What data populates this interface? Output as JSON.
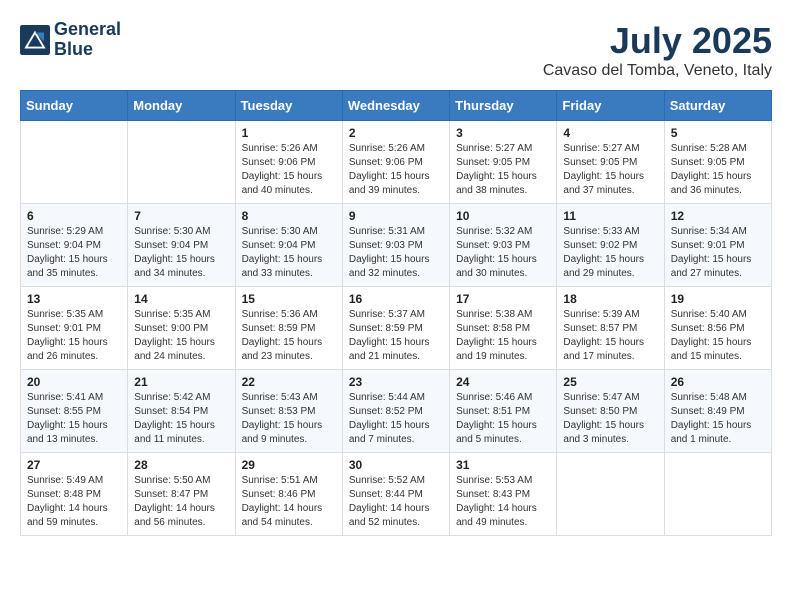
{
  "header": {
    "logo_line1": "General",
    "logo_line2": "Blue",
    "month_title": "July 2025",
    "location": "Cavaso del Tomba, Veneto, Italy"
  },
  "days_of_week": [
    "Sunday",
    "Monday",
    "Tuesday",
    "Wednesday",
    "Thursday",
    "Friday",
    "Saturday"
  ],
  "weeks": [
    [
      {
        "day": "",
        "content": ""
      },
      {
        "day": "",
        "content": ""
      },
      {
        "day": "1",
        "content": "Sunrise: 5:26 AM\nSunset: 9:06 PM\nDaylight: 15 hours and 40 minutes."
      },
      {
        "day": "2",
        "content": "Sunrise: 5:26 AM\nSunset: 9:06 PM\nDaylight: 15 hours and 39 minutes."
      },
      {
        "day": "3",
        "content": "Sunrise: 5:27 AM\nSunset: 9:05 PM\nDaylight: 15 hours and 38 minutes."
      },
      {
        "day": "4",
        "content": "Sunrise: 5:27 AM\nSunset: 9:05 PM\nDaylight: 15 hours and 37 minutes."
      },
      {
        "day": "5",
        "content": "Sunrise: 5:28 AM\nSunset: 9:05 PM\nDaylight: 15 hours and 36 minutes."
      }
    ],
    [
      {
        "day": "6",
        "content": "Sunrise: 5:29 AM\nSunset: 9:04 PM\nDaylight: 15 hours and 35 minutes."
      },
      {
        "day": "7",
        "content": "Sunrise: 5:30 AM\nSunset: 9:04 PM\nDaylight: 15 hours and 34 minutes."
      },
      {
        "day": "8",
        "content": "Sunrise: 5:30 AM\nSunset: 9:04 PM\nDaylight: 15 hours and 33 minutes."
      },
      {
        "day": "9",
        "content": "Sunrise: 5:31 AM\nSunset: 9:03 PM\nDaylight: 15 hours and 32 minutes."
      },
      {
        "day": "10",
        "content": "Sunrise: 5:32 AM\nSunset: 9:03 PM\nDaylight: 15 hours and 30 minutes."
      },
      {
        "day": "11",
        "content": "Sunrise: 5:33 AM\nSunset: 9:02 PM\nDaylight: 15 hours and 29 minutes."
      },
      {
        "day": "12",
        "content": "Sunrise: 5:34 AM\nSunset: 9:01 PM\nDaylight: 15 hours and 27 minutes."
      }
    ],
    [
      {
        "day": "13",
        "content": "Sunrise: 5:35 AM\nSunset: 9:01 PM\nDaylight: 15 hours and 26 minutes."
      },
      {
        "day": "14",
        "content": "Sunrise: 5:35 AM\nSunset: 9:00 PM\nDaylight: 15 hours and 24 minutes."
      },
      {
        "day": "15",
        "content": "Sunrise: 5:36 AM\nSunset: 8:59 PM\nDaylight: 15 hours and 23 minutes."
      },
      {
        "day": "16",
        "content": "Sunrise: 5:37 AM\nSunset: 8:59 PM\nDaylight: 15 hours and 21 minutes."
      },
      {
        "day": "17",
        "content": "Sunrise: 5:38 AM\nSunset: 8:58 PM\nDaylight: 15 hours and 19 minutes."
      },
      {
        "day": "18",
        "content": "Sunrise: 5:39 AM\nSunset: 8:57 PM\nDaylight: 15 hours and 17 minutes."
      },
      {
        "day": "19",
        "content": "Sunrise: 5:40 AM\nSunset: 8:56 PM\nDaylight: 15 hours and 15 minutes."
      }
    ],
    [
      {
        "day": "20",
        "content": "Sunrise: 5:41 AM\nSunset: 8:55 PM\nDaylight: 15 hours and 13 minutes."
      },
      {
        "day": "21",
        "content": "Sunrise: 5:42 AM\nSunset: 8:54 PM\nDaylight: 15 hours and 11 minutes."
      },
      {
        "day": "22",
        "content": "Sunrise: 5:43 AM\nSunset: 8:53 PM\nDaylight: 15 hours and 9 minutes."
      },
      {
        "day": "23",
        "content": "Sunrise: 5:44 AM\nSunset: 8:52 PM\nDaylight: 15 hours and 7 minutes."
      },
      {
        "day": "24",
        "content": "Sunrise: 5:46 AM\nSunset: 8:51 PM\nDaylight: 15 hours and 5 minutes."
      },
      {
        "day": "25",
        "content": "Sunrise: 5:47 AM\nSunset: 8:50 PM\nDaylight: 15 hours and 3 minutes."
      },
      {
        "day": "26",
        "content": "Sunrise: 5:48 AM\nSunset: 8:49 PM\nDaylight: 15 hours and 1 minute."
      }
    ],
    [
      {
        "day": "27",
        "content": "Sunrise: 5:49 AM\nSunset: 8:48 PM\nDaylight: 14 hours and 59 minutes."
      },
      {
        "day": "28",
        "content": "Sunrise: 5:50 AM\nSunset: 8:47 PM\nDaylight: 14 hours and 56 minutes."
      },
      {
        "day": "29",
        "content": "Sunrise: 5:51 AM\nSunset: 8:46 PM\nDaylight: 14 hours and 54 minutes."
      },
      {
        "day": "30",
        "content": "Sunrise: 5:52 AM\nSunset: 8:44 PM\nDaylight: 14 hours and 52 minutes."
      },
      {
        "day": "31",
        "content": "Sunrise: 5:53 AM\nSunset: 8:43 PM\nDaylight: 14 hours and 49 minutes."
      },
      {
        "day": "",
        "content": ""
      },
      {
        "day": "",
        "content": ""
      }
    ]
  ]
}
